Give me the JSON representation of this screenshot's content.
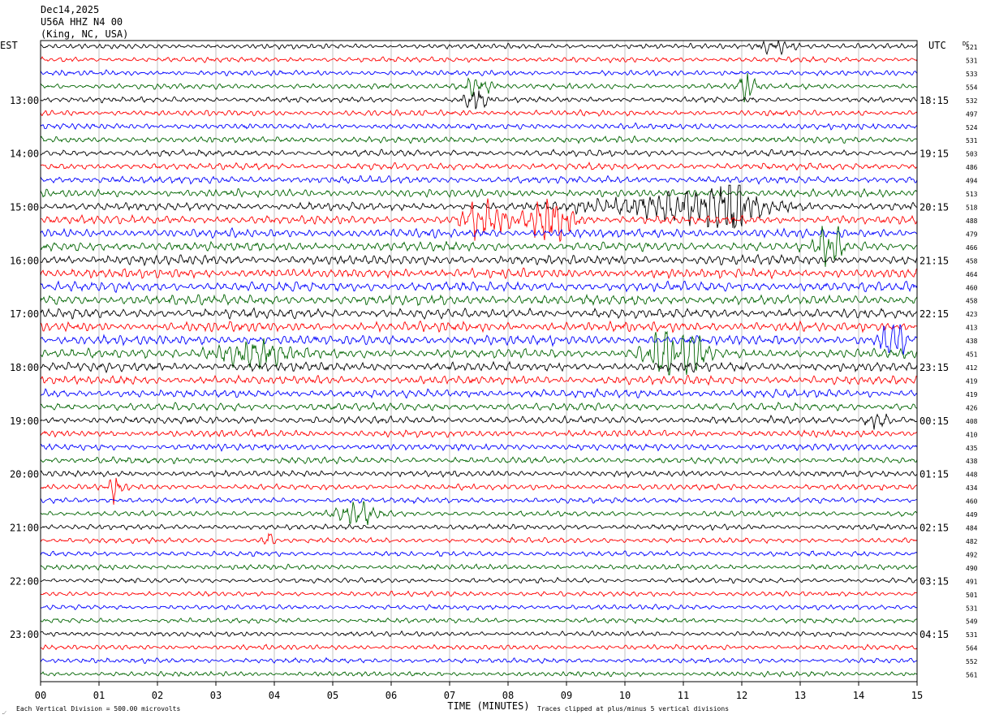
{
  "header": {
    "date": "Dec14,2025",
    "station": "U56A HHZ N4 00",
    "location": "(King, NC, USA)"
  },
  "footer": {
    "division_note": "Each Vertical Division =  500.00 microvolts",
    "clip_note": "Traces clipped at plus/minus 5 vertical divisions"
  },
  "chart_data": {
    "type": "line",
    "title": "",
    "xlabel": "TIME (MINUTES)",
    "ylabel_left": "EST",
    "ylabel_right": "UTC",
    "dc_label": "DC",
    "x_ticks": [
      "00",
      "01",
      "02",
      "03",
      "04",
      "05",
      "06",
      "07",
      "08",
      "09",
      "10",
      "11",
      "12",
      "13",
      "14",
      "15"
    ],
    "xlim": [
      0,
      15
    ],
    "left_hour_labels": [
      "13:00",
      "14:00",
      "15:00",
      "16:00",
      "17:00",
      "18:00",
      "19:00",
      "20:00",
      "21:00",
      "22:00",
      "23:00"
    ],
    "right_hour_labels": [
      "18:15",
      "19:15",
      "20:15",
      "21:15",
      "22:15",
      "23:15",
      "00:15",
      "01:15",
      "02:15",
      "03:15",
      "04:15"
    ],
    "trace_colors": [
      "#000000",
      "#ff0000",
      "#0000ff",
      "#006400"
    ],
    "dc_offsets": [
      521,
      531,
      533,
      554,
      532,
      497,
      524,
      531,
      503,
      486,
      494,
      513,
      518,
      488,
      479,
      466,
      458,
      464,
      460,
      458,
      423,
      413,
      438,
      451,
      412,
      419,
      419,
      426,
      408,
      410,
      435,
      438,
      448,
      434,
      460,
      449,
      484,
      482,
      492,
      490,
      491,
      501,
      531,
      549,
      531,
      564,
      552,
      561
    ],
    "events": [
      {
        "trace": 0,
        "x": 12.6,
        "amp": 1.6,
        "width": 0.3
      },
      {
        "trace": 3,
        "x": 7.45,
        "amp": 2.4,
        "width": 0.25
      },
      {
        "trace": 3,
        "x": 12.1,
        "amp": 2.6,
        "width": 0.15
      },
      {
        "trace": 4,
        "x": 7.45,
        "amp": 1.6,
        "width": 0.2
      },
      {
        "trace": 12,
        "x": 11.0,
        "amp": 2.4,
        "width": 1.2
      },
      {
        "trace": 12,
        "x": 11.9,
        "amp": 3.2,
        "width": 0.2
      },
      {
        "trace": 13,
        "x": 7.6,
        "amp": 2.2,
        "width": 0.35
      },
      {
        "trace": 13,
        "x": 8.75,
        "amp": 3.2,
        "width": 0.35
      },
      {
        "trace": 15,
        "x": 13.5,
        "amp": 2.2,
        "width": 0.2
      },
      {
        "trace": 22,
        "x": 14.6,
        "amp": 2.0,
        "width": 0.2
      },
      {
        "trace": 23,
        "x": 3.5,
        "amp": 1.6,
        "width": 0.6
      },
      {
        "trace": 23,
        "x": 10.7,
        "amp": 2.6,
        "width": 0.35
      },
      {
        "trace": 23,
        "x": 11.2,
        "amp": 1.8,
        "width": 0.2
      },
      {
        "trace": 28,
        "x": 14.3,
        "amp": 1.6,
        "width": 0.2
      },
      {
        "trace": 33,
        "x": 1.3,
        "amp": 2.4,
        "width": 0.1
      },
      {
        "trace": 35,
        "x": 5.4,
        "amp": 1.8,
        "width": 0.35
      },
      {
        "trace": 37,
        "x": 3.9,
        "amp": 2.2,
        "width": 0.08
      }
    ]
  }
}
